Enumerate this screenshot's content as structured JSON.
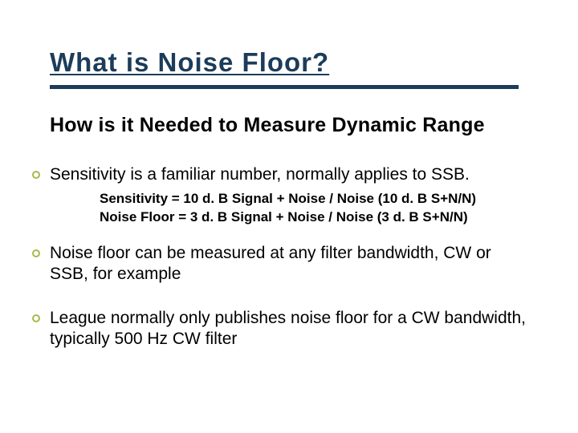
{
  "title": "What is Noise Floor?",
  "subtitle": "How is it Needed to Measure Dynamic Range",
  "body": {
    "p1": "Sensitivity is a familiar number, normally applies to SSB.",
    "sub1": "Sensitivity = 10 d. B Signal + Noise / Noise (10 d. B S+N/N)",
    "sub2": "Noise Floor = 3 d. B Signal + Noise / Noise  (3 d. B S+N/N)",
    "p2": "Noise floor can be measured at any filter bandwidth, CW or SSB, for example",
    "p3": "League normally only publishes noise floor for a CW bandwidth, typically 500 Hz CW filter"
  }
}
